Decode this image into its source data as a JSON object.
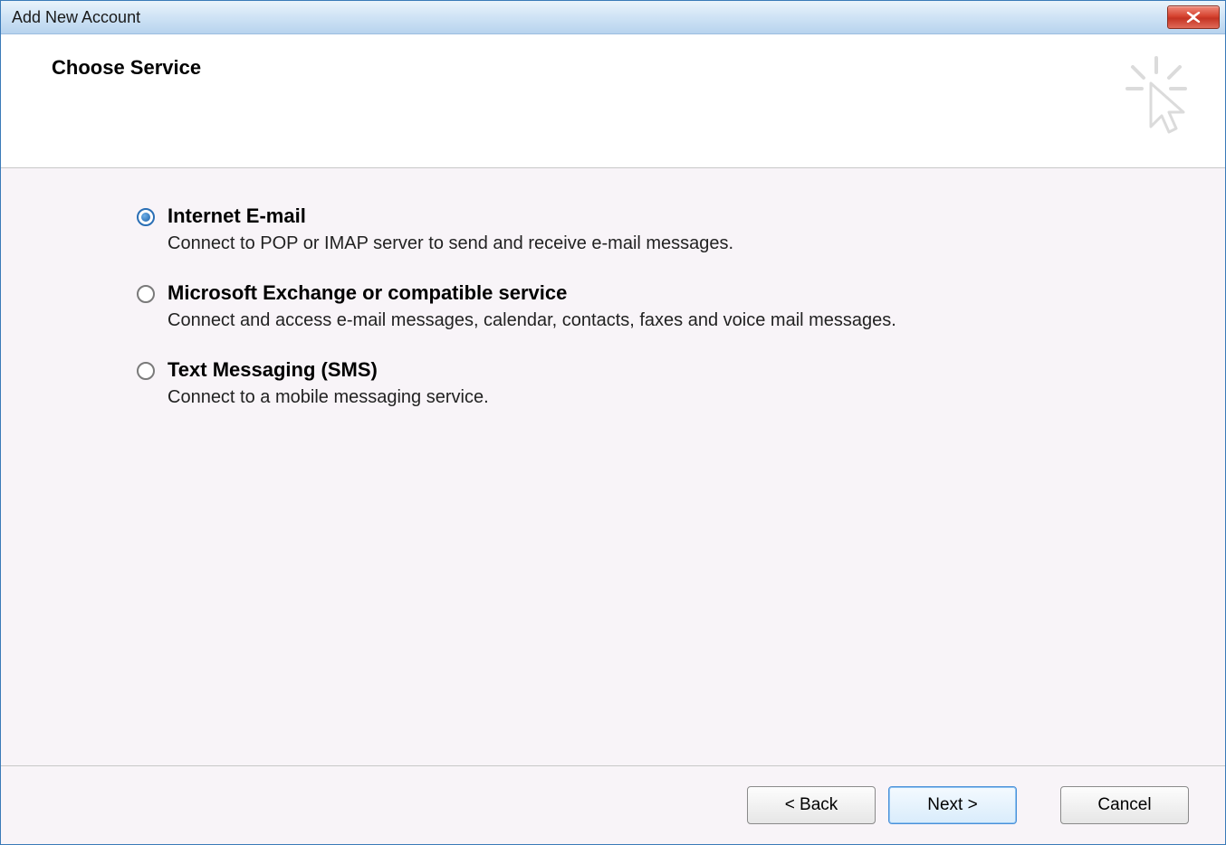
{
  "window": {
    "title": "Add New Account"
  },
  "header": {
    "title": "Choose Service"
  },
  "options": [
    {
      "title": "Internet E-mail",
      "desc": "Connect to POP or IMAP server to send and receive e-mail messages.",
      "selected": true
    },
    {
      "title": "Microsoft Exchange or compatible service",
      "desc": "Connect and access e-mail messages, calendar, contacts, faxes and voice mail messages.",
      "selected": false
    },
    {
      "title": "Text Messaging (SMS)",
      "desc": "Connect to a mobile messaging service.",
      "selected": false
    }
  ],
  "footer": {
    "back": "< Back",
    "next": "Next >",
    "cancel": "Cancel"
  }
}
